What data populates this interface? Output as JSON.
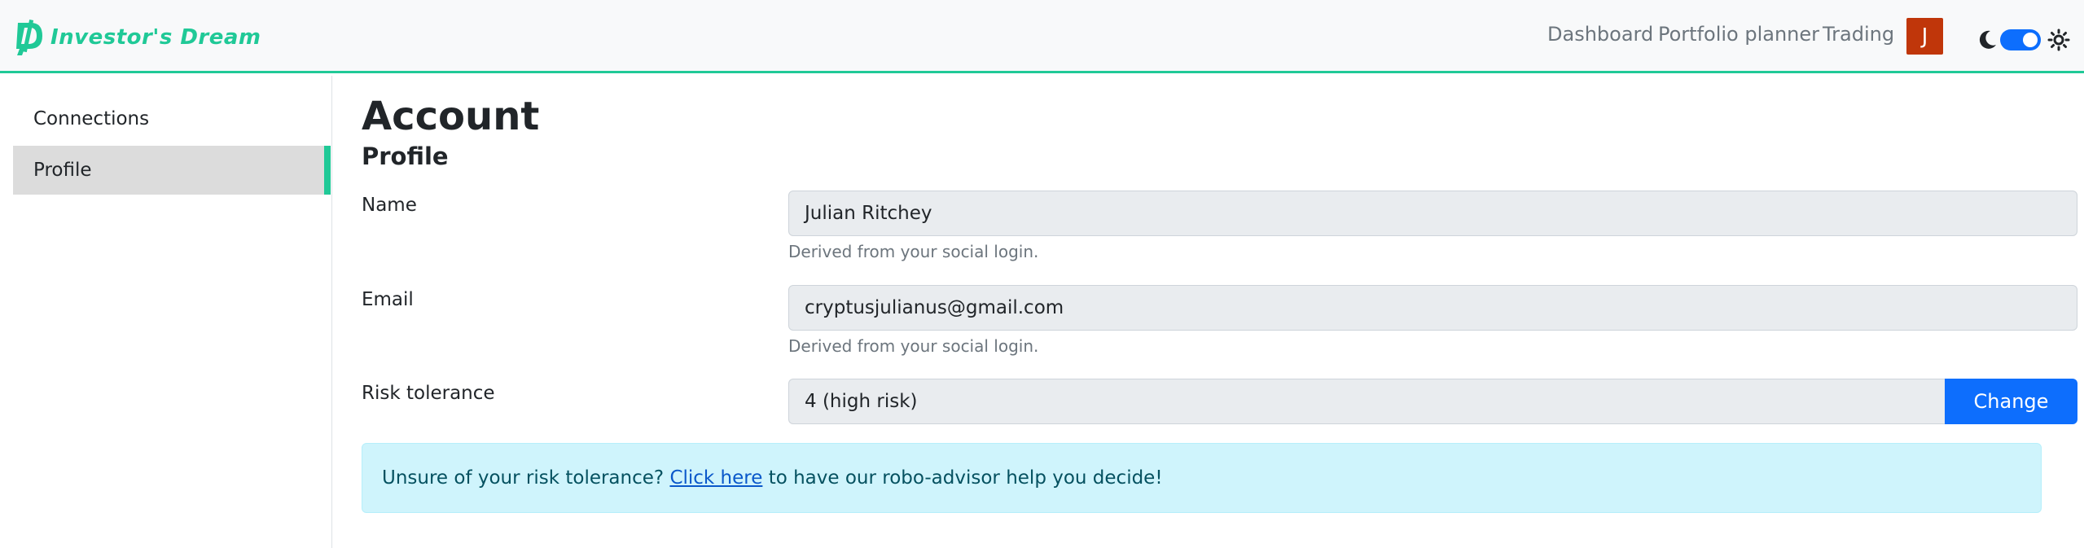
{
  "navbar": {
    "brand": "Investor's Dream",
    "links": [
      "Dashboard",
      "Portfolio planner",
      "Trading"
    ],
    "avatar_initial": "J",
    "theme_toggle": {
      "mode_left_icon": "moon-icon",
      "mode_right_icon": "sun-icon",
      "checked": true
    }
  },
  "sidebar": {
    "items": [
      {
        "label": "Connections",
        "active": false
      },
      {
        "label": "Profile",
        "active": true
      }
    ]
  },
  "main": {
    "title": "Account",
    "section": "Profile",
    "fields": {
      "name": {
        "label": "Name",
        "value": "Julian Ritchey",
        "help": "Derived from your social login."
      },
      "email": {
        "label": "Email",
        "value": "cryptusjulianus@gmail.com",
        "help": "Derived from your social login."
      },
      "risk": {
        "label": "Risk tolerance",
        "value": "4 (high risk)",
        "button": "Change"
      }
    },
    "alert": {
      "before": "Unsure of your risk tolerance? ",
      "link": "Click here",
      "after": " to have our robo-advisor help you decide!"
    }
  },
  "colors": {
    "accent": "#20c997",
    "primary": "#0d6efd",
    "avatar_bg": "#c0360a",
    "alert_bg": "#cff4fc"
  }
}
